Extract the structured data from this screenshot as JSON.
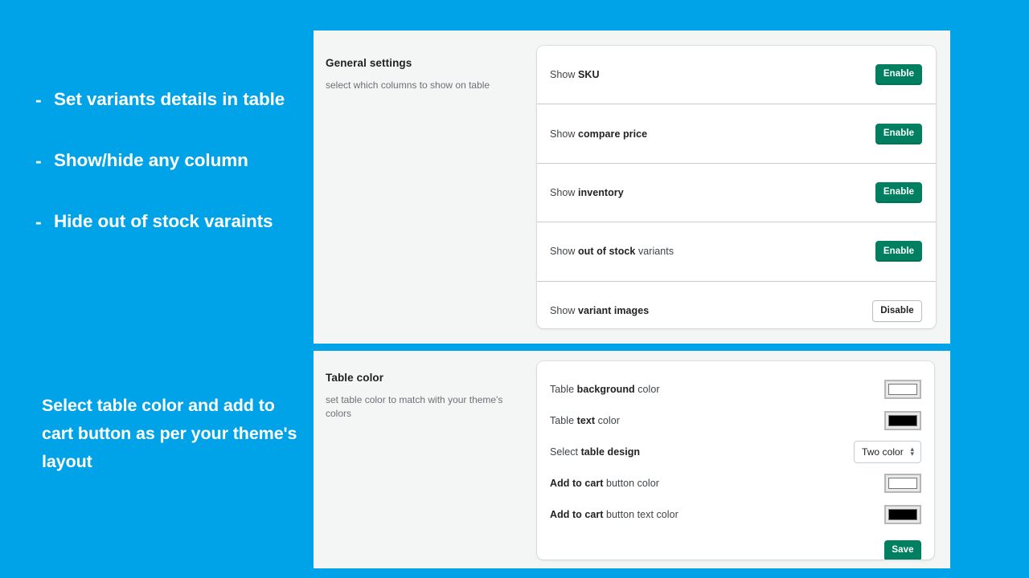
{
  "theme": {
    "brand_blue": "#00a3e8",
    "panel_gray": "#f4f5f5",
    "primary_green": "#008060",
    "card_white": "#ffffff"
  },
  "promo": {
    "bullets": [
      {
        "marker": "-",
        "text": "Set variants details in table"
      },
      {
        "marker": "-",
        "text": "Show/hide any column"
      },
      {
        "marker": "-",
        "text": "Hide out of stock varaints"
      }
    ],
    "note": "Select table color and add to cart button as per your theme's layout"
  },
  "general_settings": {
    "title": "General settings",
    "subtitle": "select which columns to show on table",
    "rows": [
      {
        "label_prefix": "Show ",
        "label_strong": "SKU",
        "label_suffix": "",
        "button": "Enable",
        "state": "enabled"
      },
      {
        "label_prefix": "Show ",
        "label_strong": "compare price",
        "label_suffix": "",
        "button": "Enable",
        "state": "enabled"
      },
      {
        "label_prefix": "Show ",
        "label_strong": "inventory",
        "label_suffix": "",
        "button": "Enable",
        "state": "enabled"
      },
      {
        "label_prefix": "Show ",
        "label_strong": "out of stock",
        "label_suffix": " variants",
        "button": "Enable",
        "state": "enabled"
      },
      {
        "label_prefix": "Show ",
        "label_strong": "variant images",
        "label_suffix": "",
        "button": "Disable",
        "state": "disabled"
      }
    ]
  },
  "table_color": {
    "title": "Table color",
    "subtitle": "set table color to match with your theme's colors",
    "rows": [
      {
        "label_prefix": "Table ",
        "label_strong": "background",
        "label_suffix": " color",
        "control": "color",
        "value": "#ffffff"
      },
      {
        "label_prefix": "Table ",
        "label_strong": "text",
        "label_suffix": " color",
        "control": "color",
        "value": "#000000"
      },
      {
        "label_prefix": "Select ",
        "label_strong": "table design",
        "label_suffix": "",
        "control": "select",
        "value": "Two color"
      },
      {
        "label_prefix": "",
        "label_strong": "Add to cart",
        "label_suffix": " button color",
        "control": "color",
        "value": "#ffffff"
      },
      {
        "label_prefix": "",
        "label_strong": "Add to cart",
        "label_suffix": " button text color",
        "control": "color",
        "value": "#000000"
      }
    ],
    "save_label": "Save"
  }
}
